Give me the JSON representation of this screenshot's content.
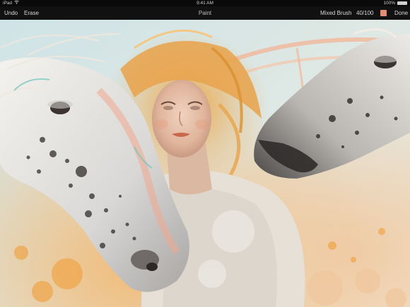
{
  "statusbar": {
    "device": "iPad",
    "time": "9:41 AM",
    "battery": "100%"
  },
  "toolbar": {
    "undo_label": "Undo",
    "erase_label": "Erase",
    "title": "Paint",
    "brush_label": "Mixed Brush",
    "opacity_label": "40/100",
    "done_label": "Done"
  },
  "colors": {
    "swatch": "#e08f72",
    "toolbar_bg": "#111111"
  },
  "icons": {
    "wifi": "wifi-icon",
    "battery": "battery-icon"
  }
}
